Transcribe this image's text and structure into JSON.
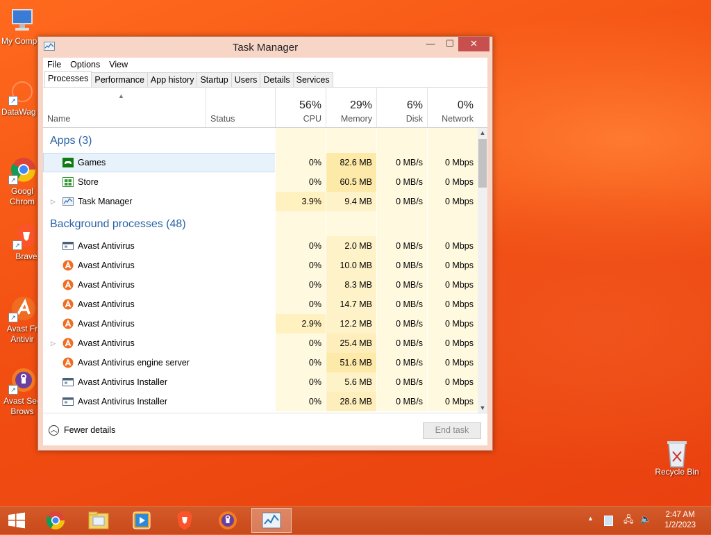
{
  "desktop": {
    "icons": [
      {
        "label": "My Comp",
        "icon": "computer-icon"
      },
      {
        "label": "DataWag",
        "icon": "datawag-icon"
      },
      {
        "label": "Googl\nChrom",
        "icon": "chrome-icon"
      },
      {
        "label": "Brave",
        "icon": "brave-icon"
      },
      {
        "label": "Avast Fr\nAntivir",
        "icon": "avast-icon"
      },
      {
        "label": "Avast Sec\nBrows",
        "icon": "avast-browser-icon"
      },
      {
        "label": "Recycle Bin",
        "icon": "recycle-bin-icon"
      }
    ]
  },
  "window": {
    "title": "Task Manager",
    "controls": {
      "minimize": "—",
      "maximize": "☐",
      "close": "✕"
    },
    "menu": [
      "File",
      "Options",
      "View"
    ],
    "tabs": [
      "Processes",
      "Performance",
      "App history",
      "Startup",
      "Users",
      "Details",
      "Services"
    ],
    "active_tab": "Processes",
    "columns": {
      "name": "Name",
      "status": "Status",
      "cpu": {
        "pct": "56%",
        "label": "CPU"
      },
      "memory": {
        "pct": "29%",
        "label": "Memory"
      },
      "disk": {
        "pct": "6%",
        "label": "Disk"
      },
      "network": {
        "pct": "0%",
        "label": "Network"
      }
    },
    "groups": {
      "apps": {
        "title": "Apps (3)",
        "rows": [
          {
            "name": "Games",
            "icon": "games-icon",
            "cpu": "0%",
            "memory": "82.6 MB",
            "disk": "0 MB/s",
            "network": "0 Mbps",
            "expandable": false,
            "selected": true
          },
          {
            "name": "Store",
            "icon": "store-icon",
            "cpu": "0%",
            "memory": "60.5 MB",
            "disk": "0 MB/s",
            "network": "0 Mbps",
            "expandable": false
          },
          {
            "name": "Task Manager",
            "icon": "task-manager-icon",
            "cpu": "3.9%",
            "memory": "9.4 MB",
            "disk": "0 MB/s",
            "network": "0 Mbps",
            "expandable": true
          }
        ]
      },
      "background": {
        "title": "Background processes (48)",
        "rows": [
          {
            "name": "Avast Antivirus",
            "icon": "window-app-icon",
            "cpu": "0%",
            "memory": "2.0 MB",
            "disk": "0 MB/s",
            "network": "0 Mbps",
            "expandable": false
          },
          {
            "name": "Avast Antivirus",
            "icon": "avast-icon",
            "cpu": "0%",
            "memory": "10.0 MB",
            "disk": "0 MB/s",
            "network": "0 Mbps",
            "expandable": false
          },
          {
            "name": "Avast Antivirus",
            "icon": "avast-icon",
            "cpu": "0%",
            "memory": "8.3 MB",
            "disk": "0 MB/s",
            "network": "0 Mbps",
            "expandable": false
          },
          {
            "name": "Avast Antivirus",
            "icon": "avast-icon",
            "cpu": "0%",
            "memory": "14.7 MB",
            "disk": "0 MB/s",
            "network": "0 Mbps",
            "expandable": false
          },
          {
            "name": "Avast Antivirus",
            "icon": "avast-icon",
            "cpu": "2.9%",
            "memory": "12.2 MB",
            "disk": "0 MB/s",
            "network": "0 Mbps",
            "expandable": false
          },
          {
            "name": "Avast Antivirus",
            "icon": "avast-icon",
            "cpu": "0%",
            "memory": "25.4 MB",
            "disk": "0 MB/s",
            "network": "0 Mbps",
            "expandable": true
          },
          {
            "name": "Avast Antivirus engine server",
            "icon": "avast-icon",
            "cpu": "0%",
            "memory": "51.6 MB",
            "disk": "0 MB/s",
            "network": "0 Mbps",
            "expandable": false
          },
          {
            "name": "Avast Antivirus Installer",
            "icon": "window-app-icon",
            "cpu": "0%",
            "memory": "5.6 MB",
            "disk": "0 MB/s",
            "network": "0 Mbps",
            "expandable": false
          },
          {
            "name": "Avast Antivirus Installer",
            "icon": "window-app-icon",
            "cpu": "0%",
            "memory": "28.6 MB",
            "disk": "0 MB/s",
            "network": "0 Mbps",
            "expandable": false
          }
        ]
      }
    },
    "footer": {
      "fewer_details": "Fewer details",
      "end_task": "End task"
    }
  },
  "taskbar": {
    "apps": [
      "start-icon",
      "chrome-icon",
      "file-explorer-icon",
      "media-player-icon",
      "brave-icon",
      "avast-browser-icon",
      "task-manager-icon"
    ],
    "active_app": "task-manager-icon",
    "clock": {
      "time": "2:47 AM",
      "date": "1/2/2023"
    }
  },
  "colors": {
    "group_title": "#2a62a4",
    "cpu_heat_light": "#fff9e0",
    "cpu_heat_medium": "#fff1c0",
    "memory_heat": "#fdeebb",
    "avast_orange": "#f06c21",
    "close_red": "#c7504f"
  }
}
